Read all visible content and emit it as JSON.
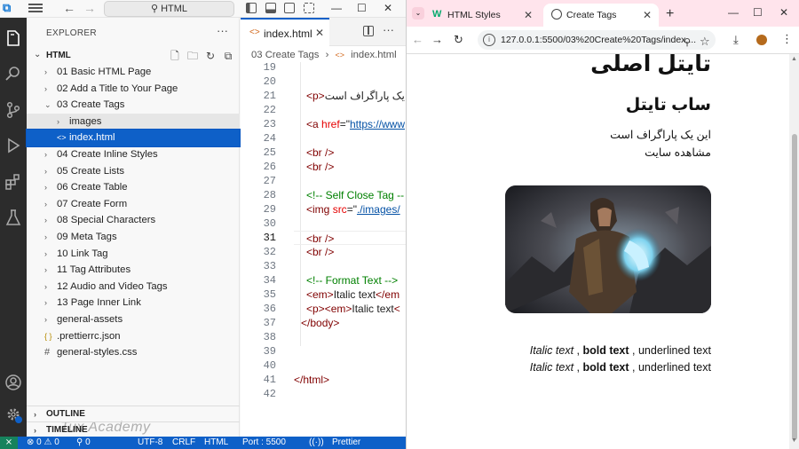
{
  "vscode": {
    "search_text": "HTML",
    "explorer": {
      "title": "EXPLORER",
      "more": "···",
      "root_label": "HTML",
      "items": [
        {
          "label": "01 Basic HTML Page",
          "kind": "folder",
          "open": false,
          "depth": 1
        },
        {
          "label": "02 Add a Title to Your Page",
          "kind": "folder",
          "open": false,
          "depth": 1
        },
        {
          "label": "03 Create Tags",
          "kind": "folder",
          "open": true,
          "depth": 1
        },
        {
          "label": "images",
          "kind": "folder",
          "open": false,
          "depth": 2
        },
        {
          "label": "index.html",
          "kind": "html",
          "depth": 2
        },
        {
          "label": "04 Create Inline Styles",
          "kind": "folder",
          "open": false,
          "depth": 1
        },
        {
          "label": "05 Create Lists",
          "kind": "folder",
          "open": false,
          "depth": 1
        },
        {
          "label": "06 Create Table",
          "kind": "folder",
          "open": false,
          "depth": 1
        },
        {
          "label": "07 Create Form",
          "kind": "folder",
          "open": false,
          "depth": 1
        },
        {
          "label": "08 Special Characters",
          "kind": "folder",
          "open": false,
          "depth": 1
        },
        {
          "label": "09 Meta Tags",
          "kind": "folder",
          "open": false,
          "depth": 1
        },
        {
          "label": "10 Link Tag",
          "kind": "folder",
          "open": false,
          "depth": 1
        },
        {
          "label": "11 Tag Attributes",
          "kind": "folder",
          "open": false,
          "depth": 1
        },
        {
          "label": "12 Audio and Video Tags",
          "kind": "folder",
          "open": false,
          "depth": 1
        },
        {
          "label": "13 Page Inner Link",
          "kind": "folder",
          "open": false,
          "depth": 1
        },
        {
          "label": "general-assets",
          "kind": "folder",
          "open": false,
          "depth": 1
        },
        {
          "label": ".prettierrc.json",
          "kind": "json",
          "depth": 1
        },
        {
          "label": "general-styles.css",
          "kind": "css",
          "depth": 1
        }
      ],
      "outline_label": "OUTLINE",
      "timeline_label": "TIMELINE",
      "watermark": "Tux Academy"
    },
    "editor": {
      "tab_label": "index.html",
      "tab_close": "✕",
      "more": "···",
      "breadcrumb_folder": "03 Create Tags",
      "breadcrumb_file": "index.html",
      "sep": "›",
      "line_numbers": [
        "19",
        "20",
        "21",
        "22",
        "23",
        "24",
        "25",
        "26",
        "27",
        "28",
        "29",
        "30",
        "31",
        "32",
        "33",
        "34",
        "35",
        "36",
        "37",
        "38",
        "39",
        "40",
        "41",
        "42"
      ],
      "current_line": "31",
      "lines": [
        {
          "indent": 1,
          "parts": []
        },
        {
          "indent": 0,
          "parts": []
        },
        {
          "indent": 1,
          "parts": [
            {
              "t": "tag",
              "v": "<p>"
            },
            {
              "t": "txt",
              "v": "این یک پاراگراف است"
            }
          ]
        },
        {
          "indent": 0,
          "parts": []
        },
        {
          "indent": 1,
          "parts": [
            {
              "t": "tag",
              "v": "<a "
            },
            {
              "t": "attr",
              "v": "href"
            },
            {
              "t": "txt",
              "v": "=\""
            },
            {
              "t": "val",
              "v": "https://www"
            }
          ]
        },
        {
          "indent": 0,
          "parts": []
        },
        {
          "indent": 1,
          "parts": [
            {
              "t": "tag",
              "v": "<br />"
            }
          ]
        },
        {
          "indent": 1,
          "parts": [
            {
              "t": "tag",
              "v": "<br />"
            }
          ]
        },
        {
          "indent": 0,
          "parts": []
        },
        {
          "indent": 1,
          "parts": [
            {
              "t": "cmt",
              "v": "<!-- Self Close Tag --"
            }
          ]
        },
        {
          "indent": 1,
          "parts": [
            {
              "t": "tag",
              "v": "<img "
            },
            {
              "t": "attr",
              "v": "src"
            },
            {
              "t": "txt",
              "v": "=\""
            },
            {
              "t": "val",
              "v": "./images/"
            }
          ]
        },
        {
          "indent": 0,
          "parts": []
        },
        {
          "indent": 1,
          "parts": [
            {
              "t": "tag",
              "v": "<br />"
            }
          ]
        },
        {
          "indent": 1,
          "parts": [
            {
              "t": "tag",
              "v": "<br />"
            }
          ]
        },
        {
          "indent": 0,
          "parts": []
        },
        {
          "indent": 1,
          "parts": [
            {
              "t": "cmt",
              "v": "<!-- Format Text -->"
            }
          ]
        },
        {
          "indent": 1,
          "parts": [
            {
              "t": "tag",
              "v": "<em>"
            },
            {
              "t": "txt",
              "v": "Italic text"
            },
            {
              "t": "tag",
              "v": "</em"
            }
          ]
        },
        {
          "indent": 1,
          "parts": [
            {
              "t": "tag",
              "v": "<p><em>"
            },
            {
              "t": "txt",
              "v": "Italic text"
            },
            {
              "t": "tag",
              "v": "<"
            }
          ]
        },
        {
          "indent": 0,
          "parts": [
            {
              "t": "tag",
              "v": "</body>"
            }
          ]
        },
        {
          "indent": 0,
          "parts": []
        },
        {
          "indent": 0,
          "parts": []
        },
        {
          "indent": 0,
          "parts": []
        },
        {
          "indent": -1,
          "parts": [
            {
              "t": "tag",
              "v": "</html>"
            }
          ]
        },
        {
          "indent": 0,
          "parts": []
        }
      ]
    },
    "statusbar": {
      "errors": "⊗ 0  ⚠ 0",
      "ports": "⚲ 0",
      "encoding": "UTF-8",
      "eol": "CRLF",
      "language": "HTML",
      "port": "Port : 5500",
      "prettier": "Prettier"
    }
  },
  "chrome": {
    "tabs": [
      {
        "label": "HTML Styles",
        "active": false
      },
      {
        "label": "Create Tags",
        "active": true
      }
    ],
    "url": "127.0.0.1:5500/03%20Create%20Tags/index....",
    "page": {
      "h1": "تایتل اصلی",
      "h2": "ساب تایتل",
      "p1": "این یک پاراگراف است",
      "link": "مشاهده سایت",
      "format_lines": [
        {
          "italic": "Italic text",
          "sep1": " , ",
          "bold": "bold text",
          "sep2": " , ",
          "under": "underlined text"
        },
        {
          "italic": "Italic text",
          "sep1": " , ",
          "bold": "bold text",
          "sep2": " , ",
          "under": "underlined text"
        }
      ]
    }
  },
  "colors": {
    "accent": "#0e60c8",
    "activity_bar": "#2c2c2c",
    "chrome_tabstrip": "#ffe4ec",
    "tag": "#800000",
    "attr": "#e50000",
    "comment": "#008000"
  }
}
